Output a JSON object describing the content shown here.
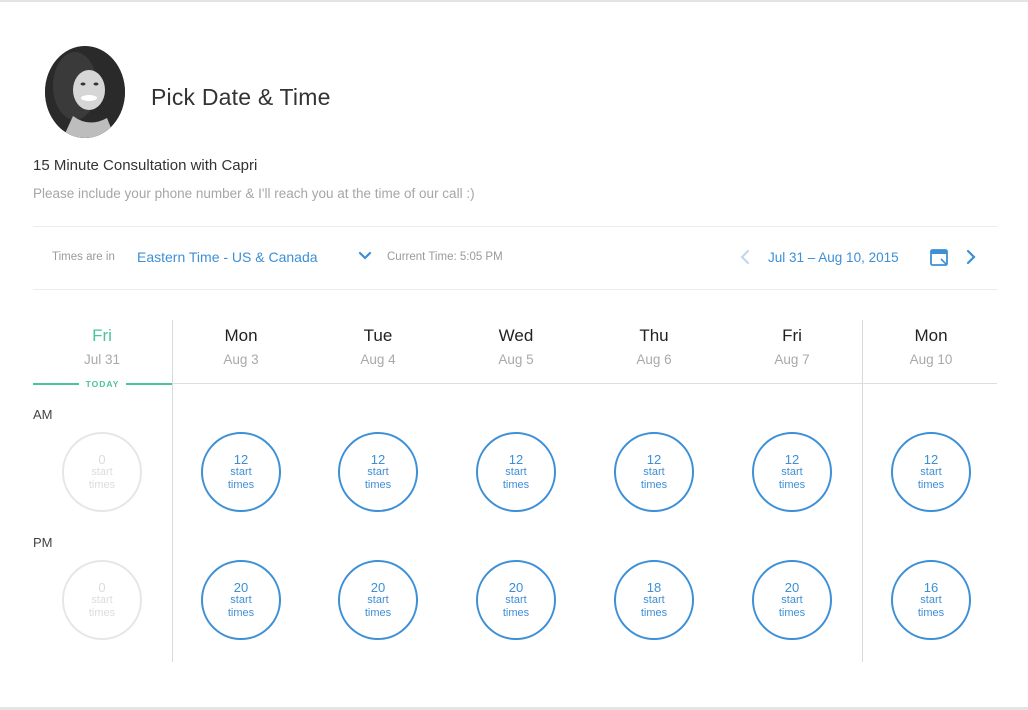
{
  "header": {
    "title": "Pick Date & Time",
    "event_name": "15 Minute Consultation with Capri",
    "event_description": "Please include your phone number & I'll reach you at the time of our call :)"
  },
  "timezone": {
    "label": "Times are in",
    "value": "Eastern Time - US & Canada",
    "current_time": "Current Time: 5:05 PM"
  },
  "range": {
    "text": "Jul 31 – Aug 10, 2015"
  },
  "today_label": "TODAY",
  "periods": {
    "am": "AM",
    "pm": "PM"
  },
  "slot_label": {
    "start": "start",
    "times": "times"
  },
  "days": [
    {
      "name": "Fri",
      "date": "Jul 31",
      "today": true,
      "am": "0",
      "pm": "0"
    },
    {
      "name": "Mon",
      "date": "Aug 3",
      "today": false,
      "am": "12",
      "pm": "20"
    },
    {
      "name": "Tue",
      "date": "Aug 4",
      "today": false,
      "am": "12",
      "pm": "20"
    },
    {
      "name": "Wed",
      "date": "Aug 5",
      "today": false,
      "am": "12",
      "pm": "20"
    },
    {
      "name": "Thu",
      "date": "Aug 6",
      "today": false,
      "am": "12",
      "pm": "18"
    },
    {
      "name": "Fri",
      "date": "Aug 7",
      "today": false,
      "am": "12",
      "pm": "20"
    },
    {
      "name": "Mon",
      "date": "Aug 10",
      "today": false,
      "am": "12",
      "pm": "16"
    }
  ],
  "colors": {
    "accent": "#3d8fd6",
    "today": "#4bc596",
    "muted": "#a6a6a6"
  },
  "icons": {
    "timezone_toggle": "chevron-down-icon",
    "prev": "chevron-left-icon",
    "calendar": "calendar-icon",
    "next": "chevron-right-icon"
  }
}
